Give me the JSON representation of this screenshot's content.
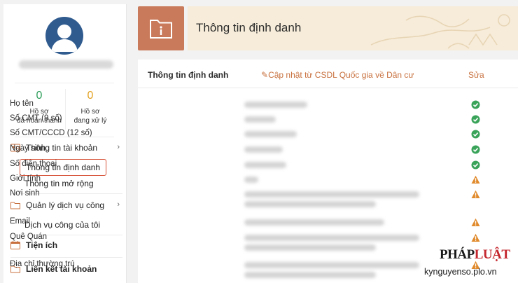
{
  "sidebar": {
    "stats": [
      {
        "value": "0",
        "label_1": "Hồ sơ",
        "label_2": "đã hoàn thành"
      },
      {
        "value": "0",
        "label_1": "Hồ sơ",
        "label_2": "đang xử lý"
      }
    ],
    "menu": {
      "account": "Thông tin tài khoản",
      "account_sub": [
        "Thông tin định danh",
        "Thông tin mở rộng"
      ],
      "public_services": "Quản lý dịch vụ công",
      "public_sub": [
        "Dịch vụ công của tôi"
      ],
      "utilities": "Tiện ích",
      "linked": "Liên kết tài khoản"
    }
  },
  "header": {
    "title": "Thông tin định danh"
  },
  "card": {
    "title": "Thông tin định danh",
    "update_link": "Cập nhật từ CSDL Quốc gia về Dân cư",
    "edit_link": "Sửa",
    "rows": [
      {
        "label": "Họ tên",
        "status": "ok"
      },
      {
        "label": "Số CMT (9 số)",
        "status": "ok"
      },
      {
        "label": "Số CMT/CCCD (12 số)",
        "status": "ok"
      },
      {
        "label": "Ngày sinh",
        "status": "ok"
      },
      {
        "label": "Số điện thoại",
        "status": "ok"
      },
      {
        "label": "Giới tính",
        "status": "warning"
      },
      {
        "label": "Nơi sinh",
        "status": "warning"
      },
      {
        "label": "Email",
        "status": "warning"
      },
      {
        "label": "Quê Quán",
        "status": "warning"
      },
      {
        "label": "Địa chỉ thường trú",
        "status": "warning"
      }
    ]
  },
  "watermark": {
    "logo_a": "PHÁP",
    "logo_b": "LUẬT",
    "url": "kynguyenso.plo.vn"
  },
  "colors": {
    "accent": "#c8713f",
    "ok": "#3aa35a",
    "warning": "#e08a2c",
    "active_border": "#d6553b"
  }
}
